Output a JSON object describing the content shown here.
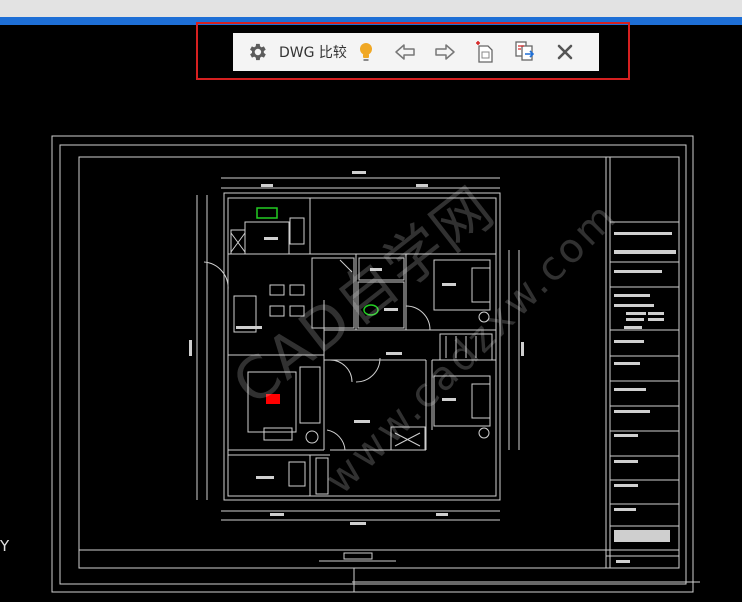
{
  "toolbar": {
    "title": "DWG 比较",
    "buttons": [
      {
        "name": "settings",
        "icon": "gear-icon"
      },
      {
        "name": "hint",
        "icon": "lightbulb-icon"
      },
      {
        "name": "previous",
        "icon": "arrow-left-icon"
      },
      {
        "name": "next",
        "icon": "arrow-right-icon"
      },
      {
        "name": "export-snapshot",
        "icon": "document-export-icon"
      },
      {
        "name": "compare-files",
        "icon": "compare-documents-icon"
      },
      {
        "name": "close",
        "icon": "close-icon"
      }
    ]
  },
  "canvas": {
    "ucs_axis_label": "Y",
    "watermark": "CAD自学网",
    "watermark_url": "www.cadzxw.com"
  },
  "colors": {
    "background": "#000000",
    "window_bar": "#e3e3e3",
    "accent_blue": "#1e6fd6",
    "highlight_red": "#d62020",
    "toolbar_bg": "#f4f4f4",
    "lightbulb": "#f0a825",
    "drawing_lines": "#cfcfcf",
    "green_fixture": "#22cc22",
    "red_object": "#ff0000"
  }
}
